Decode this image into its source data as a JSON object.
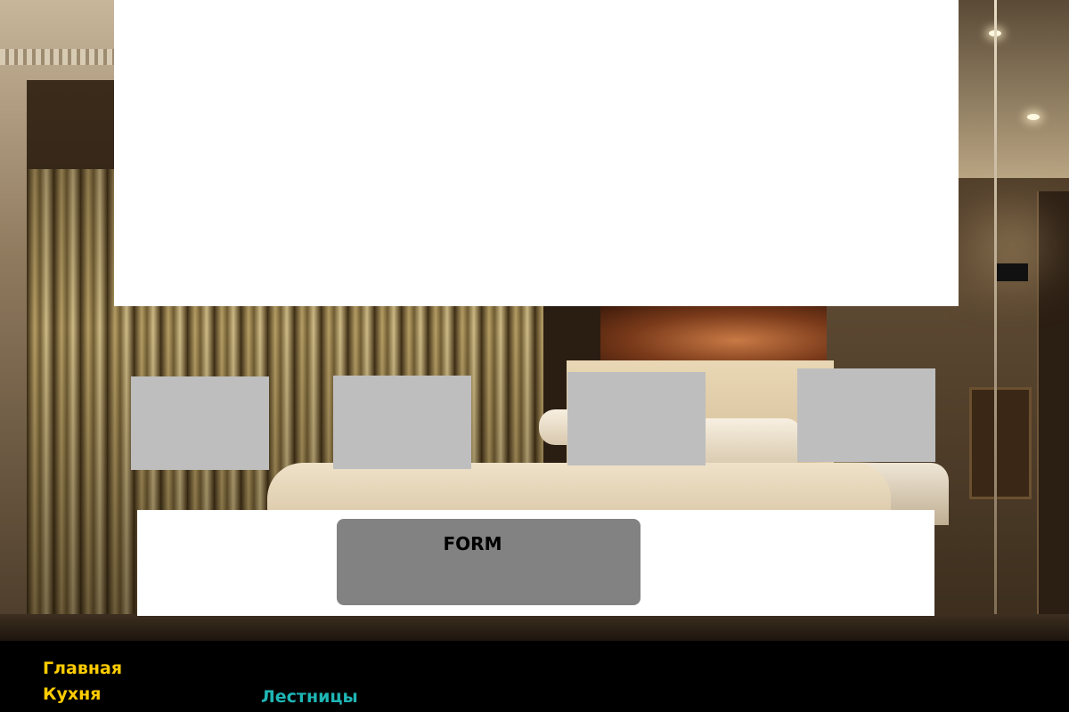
{
  "form": {
    "title": "FORM"
  },
  "nav": {
    "links": [
      {
        "label": "Главная",
        "color": "#ffcc00"
      },
      {
        "label": "Кухня",
        "color": "#ffcc00"
      },
      {
        "label": "Лестницы",
        "color": "#1fb5b5"
      }
    ]
  },
  "colors": {
    "banner": "#ffffff",
    "tile": "#bebebe",
    "form_box": "#828282",
    "footer": "#000000"
  },
  "background_image": {
    "subject": "hotel bedroom photo with gold curtains and lit headboard"
  }
}
